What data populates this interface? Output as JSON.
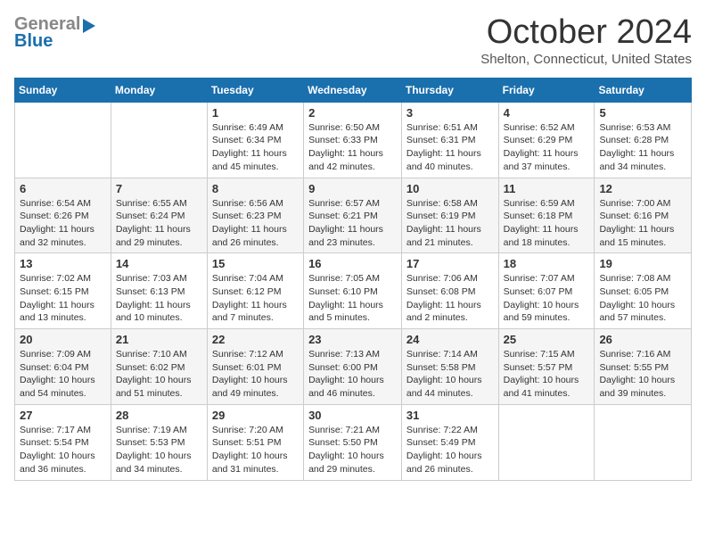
{
  "header": {
    "logo_general": "General",
    "logo_blue": "Blue",
    "month_title": "October 2024",
    "location": "Shelton, Connecticut, United States"
  },
  "columns": [
    "Sunday",
    "Monday",
    "Tuesday",
    "Wednesday",
    "Thursday",
    "Friday",
    "Saturday"
  ],
  "weeks": [
    [
      {
        "day": "",
        "info": ""
      },
      {
        "day": "",
        "info": ""
      },
      {
        "day": "1",
        "info": "Sunrise: 6:49 AM\nSunset: 6:34 PM\nDaylight: 11 hours and 45 minutes."
      },
      {
        "day": "2",
        "info": "Sunrise: 6:50 AM\nSunset: 6:33 PM\nDaylight: 11 hours and 42 minutes."
      },
      {
        "day": "3",
        "info": "Sunrise: 6:51 AM\nSunset: 6:31 PM\nDaylight: 11 hours and 40 minutes."
      },
      {
        "day": "4",
        "info": "Sunrise: 6:52 AM\nSunset: 6:29 PM\nDaylight: 11 hours and 37 minutes."
      },
      {
        "day": "5",
        "info": "Sunrise: 6:53 AM\nSunset: 6:28 PM\nDaylight: 11 hours and 34 minutes."
      }
    ],
    [
      {
        "day": "6",
        "info": "Sunrise: 6:54 AM\nSunset: 6:26 PM\nDaylight: 11 hours and 32 minutes."
      },
      {
        "day": "7",
        "info": "Sunrise: 6:55 AM\nSunset: 6:24 PM\nDaylight: 11 hours and 29 minutes."
      },
      {
        "day": "8",
        "info": "Sunrise: 6:56 AM\nSunset: 6:23 PM\nDaylight: 11 hours and 26 minutes."
      },
      {
        "day": "9",
        "info": "Sunrise: 6:57 AM\nSunset: 6:21 PM\nDaylight: 11 hours and 23 minutes."
      },
      {
        "day": "10",
        "info": "Sunrise: 6:58 AM\nSunset: 6:19 PM\nDaylight: 11 hours and 21 minutes."
      },
      {
        "day": "11",
        "info": "Sunrise: 6:59 AM\nSunset: 6:18 PM\nDaylight: 11 hours and 18 minutes."
      },
      {
        "day": "12",
        "info": "Sunrise: 7:00 AM\nSunset: 6:16 PM\nDaylight: 11 hours and 15 minutes."
      }
    ],
    [
      {
        "day": "13",
        "info": "Sunrise: 7:02 AM\nSunset: 6:15 PM\nDaylight: 11 hours and 13 minutes."
      },
      {
        "day": "14",
        "info": "Sunrise: 7:03 AM\nSunset: 6:13 PM\nDaylight: 11 hours and 10 minutes."
      },
      {
        "day": "15",
        "info": "Sunrise: 7:04 AM\nSunset: 6:12 PM\nDaylight: 11 hours and 7 minutes."
      },
      {
        "day": "16",
        "info": "Sunrise: 7:05 AM\nSunset: 6:10 PM\nDaylight: 11 hours and 5 minutes."
      },
      {
        "day": "17",
        "info": "Sunrise: 7:06 AM\nSunset: 6:08 PM\nDaylight: 11 hours and 2 minutes."
      },
      {
        "day": "18",
        "info": "Sunrise: 7:07 AM\nSunset: 6:07 PM\nDaylight: 10 hours and 59 minutes."
      },
      {
        "day": "19",
        "info": "Sunrise: 7:08 AM\nSunset: 6:05 PM\nDaylight: 10 hours and 57 minutes."
      }
    ],
    [
      {
        "day": "20",
        "info": "Sunrise: 7:09 AM\nSunset: 6:04 PM\nDaylight: 10 hours and 54 minutes."
      },
      {
        "day": "21",
        "info": "Sunrise: 7:10 AM\nSunset: 6:02 PM\nDaylight: 10 hours and 51 minutes."
      },
      {
        "day": "22",
        "info": "Sunrise: 7:12 AM\nSunset: 6:01 PM\nDaylight: 10 hours and 49 minutes."
      },
      {
        "day": "23",
        "info": "Sunrise: 7:13 AM\nSunset: 6:00 PM\nDaylight: 10 hours and 46 minutes."
      },
      {
        "day": "24",
        "info": "Sunrise: 7:14 AM\nSunset: 5:58 PM\nDaylight: 10 hours and 44 minutes."
      },
      {
        "day": "25",
        "info": "Sunrise: 7:15 AM\nSunset: 5:57 PM\nDaylight: 10 hours and 41 minutes."
      },
      {
        "day": "26",
        "info": "Sunrise: 7:16 AM\nSunset: 5:55 PM\nDaylight: 10 hours and 39 minutes."
      }
    ],
    [
      {
        "day": "27",
        "info": "Sunrise: 7:17 AM\nSunset: 5:54 PM\nDaylight: 10 hours and 36 minutes."
      },
      {
        "day": "28",
        "info": "Sunrise: 7:19 AM\nSunset: 5:53 PM\nDaylight: 10 hours and 34 minutes."
      },
      {
        "day": "29",
        "info": "Sunrise: 7:20 AM\nSunset: 5:51 PM\nDaylight: 10 hours and 31 minutes."
      },
      {
        "day": "30",
        "info": "Sunrise: 7:21 AM\nSunset: 5:50 PM\nDaylight: 10 hours and 29 minutes."
      },
      {
        "day": "31",
        "info": "Sunrise: 7:22 AM\nSunset: 5:49 PM\nDaylight: 10 hours and 26 minutes."
      },
      {
        "day": "",
        "info": ""
      },
      {
        "day": "",
        "info": ""
      }
    ]
  ]
}
